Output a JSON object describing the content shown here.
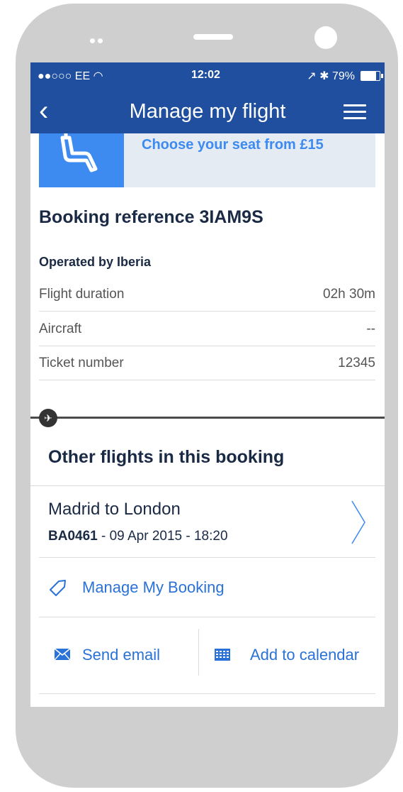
{
  "status_bar": {
    "carrier": "●●○○○ EE",
    "time": "12:02",
    "battery": "79%",
    "battery_level": 0.79
  },
  "nav": {
    "title": "Manage my flight",
    "back_icon": "chevron-left-icon",
    "menu_icon": "hamburger-icon"
  },
  "seat_banner": {
    "text": "Choose your seat from £15",
    "icon": "seat-icon"
  },
  "booking": {
    "reference_label": "Booking reference 3IAM9S",
    "operated_by": "Operated by Iberia",
    "details": [
      {
        "label": "Flight duration",
        "value": "02h 30m"
      },
      {
        "label": "Aircraft",
        "value": "--"
      },
      {
        "label": "Ticket number",
        "value": "12345"
      }
    ]
  },
  "other_flights": {
    "title": "Other flights in this booking",
    "flights": [
      {
        "route": "Madrid to London",
        "flight_no": "BA0461",
        "details": " - 09 Apr 2015 - 18:20"
      }
    ]
  },
  "actions": {
    "manage_booking": "Manage My Booking",
    "send_email": "Send email",
    "add_calendar": "Add to calendar"
  },
  "colors": {
    "header": "#1f4f9e",
    "accent": "#3d8af0",
    "link": "#2a72d8",
    "frame": "#cfcfcf"
  }
}
